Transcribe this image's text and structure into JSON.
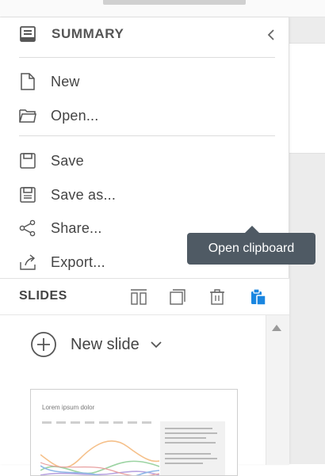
{
  "summary": {
    "title": "SUMMARY",
    "items": [
      {
        "label": "New",
        "icon": "new-file-icon"
      },
      {
        "label": "Open...",
        "icon": "folder-open-icon"
      },
      {
        "label": "Save",
        "icon": "save-icon"
      },
      {
        "label": "Save as...",
        "icon": "save-as-icon"
      },
      {
        "label": "Share...",
        "icon": "share-icon"
      },
      {
        "label": "Export...",
        "icon": "export-icon"
      }
    ]
  },
  "slides": {
    "title": "SLIDES",
    "tools": [
      "columns-icon",
      "duplicate-icon",
      "delete-icon",
      "clipboard-icon"
    ],
    "new_slide_label": "New slide",
    "thumbnail_title": "Lorem ipsum dolor"
  },
  "tooltip": {
    "text": "Open clipboard"
  },
  "colors": {
    "accent": "#1a86e0",
    "tooltip_bg": "#4f5a64",
    "icon_gray": "#666666"
  }
}
